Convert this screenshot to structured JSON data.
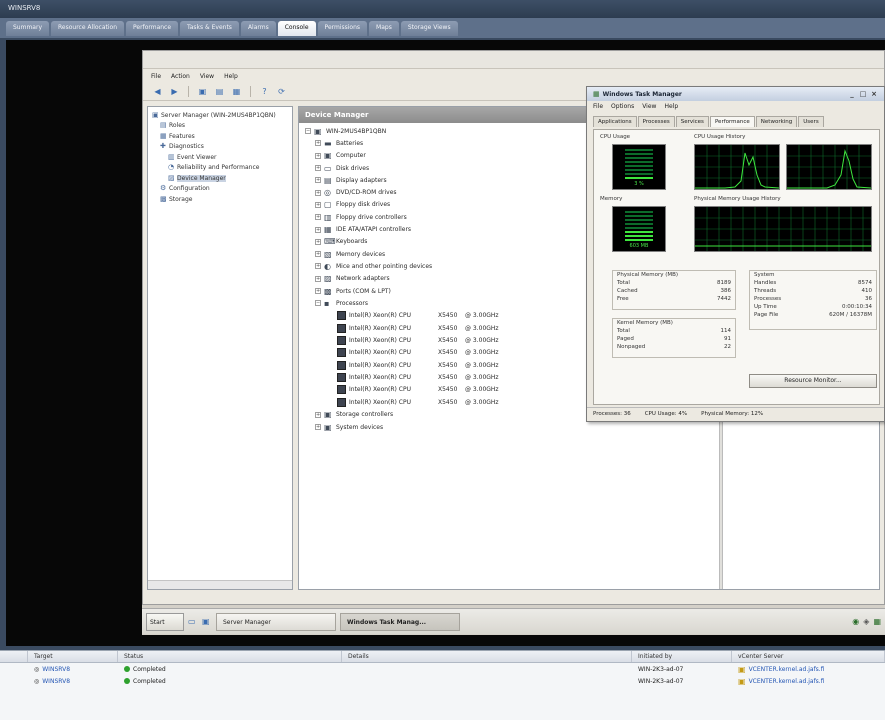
{
  "vi_client": {
    "title": "WINSRV8",
    "tabs": [
      "Summary",
      "Resource Allocation",
      "Performance",
      "Tasks & Events",
      "Alarms",
      "Console",
      "Permissions",
      "Maps",
      "Storage Views"
    ],
    "active_tab": 5
  },
  "server_manager": {
    "menu": [
      "File",
      "Action",
      "View",
      "Help"
    ],
    "nav_tree": [
      {
        "label": "Server Manager (WIN-2MUS4BP1QBN)",
        "level": 0
      },
      {
        "label": "Roles",
        "level": 1
      },
      {
        "label": "Features",
        "level": 1
      },
      {
        "label": "Diagnostics",
        "level": 1
      },
      {
        "label": "Event Viewer",
        "level": 2
      },
      {
        "label": "Reliability and Performance",
        "level": 2
      },
      {
        "label": "Device Manager",
        "level": 2,
        "selected": true
      },
      {
        "label": "Configuration",
        "level": 1
      },
      {
        "label": "Storage",
        "level": 1
      }
    ],
    "content_title": "Device Manager",
    "devices": {
      "root": "WIN-2MUS4BP1QBN",
      "categories": [
        "Batteries",
        "Computer",
        "Disk drives",
        "Display adapters",
        "DVD/CD-ROM drives",
        "Floppy disk drives",
        "Floppy drive controllers",
        "IDE ATA/ATAPI controllers",
        "Keyboards",
        "Memory devices",
        "Mice and other pointing devices",
        "Network adapters",
        "Ports (COM & LPT)",
        "Processors"
      ],
      "processors": [
        {
          "name": "Intel(R) Xeon(R) CPU",
          "model": "X5450",
          "speed": "@ 3.00GHz"
        },
        {
          "name": "Intel(R) Xeon(R) CPU",
          "model": "X5450",
          "speed": "@ 3.00GHz"
        },
        {
          "name": "Intel(R) Xeon(R) CPU",
          "model": "X5450",
          "speed": "@ 3.00GHz"
        },
        {
          "name": "Intel(R) Xeon(R) CPU",
          "model": "X5450",
          "speed": "@ 3.00GHz"
        },
        {
          "name": "Intel(R) Xeon(R) CPU",
          "model": "X5450",
          "speed": "@ 3.00GHz"
        },
        {
          "name": "Intel(R) Xeon(R) CPU",
          "model": "X5450",
          "speed": "@ 3.00GHz"
        },
        {
          "name": "Intel(R) Xeon(R) CPU",
          "model": "X5450",
          "speed": "@ 3.00GHz"
        },
        {
          "name": "Intel(R) Xeon(R) CPU",
          "model": "X5450",
          "speed": "@ 3.00GHz"
        }
      ],
      "after": [
        "Storage controllers",
        "System devices"
      ]
    }
  },
  "taskbar": {
    "start": "Start",
    "buttons": [
      "Server Manager",
      "Windows Task Manag..."
    ]
  },
  "task_manager": {
    "title": "Windows Task Manager",
    "menu": [
      "File",
      "Options",
      "View",
      "Help"
    ],
    "tabs": [
      "Applications",
      "Processes",
      "Services",
      "Performance",
      "Networking",
      "Users"
    ],
    "active_tab": 3,
    "cpu_usage_label": "CPU Usage",
    "cpu_history_label": "CPU Usage History",
    "memory_label": "Memory",
    "memory_history_label": "Physical Memory Usage History",
    "cpu_meter_value": "3 %",
    "memory_meter_value": "603 MB",
    "cpu_usage_fraction": 0.03,
    "physical_memory": {
      "title": "Physical Memory (MB)",
      "rows": [
        [
          "Total",
          "8189"
        ],
        [
          "Cached",
          "386"
        ],
        [
          "Free",
          "7442"
        ]
      ]
    },
    "kernel_memory": {
      "title": "Kernel Memory (MB)",
      "rows": [
        [
          "Total",
          "114"
        ],
        [
          "Paged",
          "91"
        ],
        [
          "Nonpaged",
          "22"
        ]
      ]
    },
    "system": {
      "title": "System",
      "rows": [
        [
          "Handles",
          "8574"
        ],
        [
          "Threads",
          "410"
        ],
        [
          "Processes",
          "36"
        ],
        [
          "Up Time",
          "0:00:10:34"
        ],
        [
          "Page File",
          "620M / 16378M"
        ]
      ]
    },
    "resource_monitor_button": "Resource Monitor...",
    "status": [
      "Processes: 36",
      "CPU Usage: 4%",
      "Physical Memory: 12%"
    ]
  },
  "recent_tasks": {
    "columns": [
      "",
      "Target",
      "Status",
      "Details",
      "Initiated by",
      "vCenter Server"
    ],
    "rows": [
      {
        "target": "WINSRV8",
        "status": "Completed",
        "initiated_by": "WIN-2K3-ad-07",
        "vcenter": "VCENTER.kernel.ad.jafs.fi"
      },
      {
        "target": "WINSRV8",
        "status": "Completed",
        "initiated_by": "WIN-2K3-ad-07",
        "vcenter": "VCENTER.kernel.ad.jafs.fi"
      }
    ]
  },
  "colors": {
    "vi_tabbar": "#5e708a",
    "graph_green": "#3ee63e",
    "grid_green": "#0c6b2a"
  }
}
